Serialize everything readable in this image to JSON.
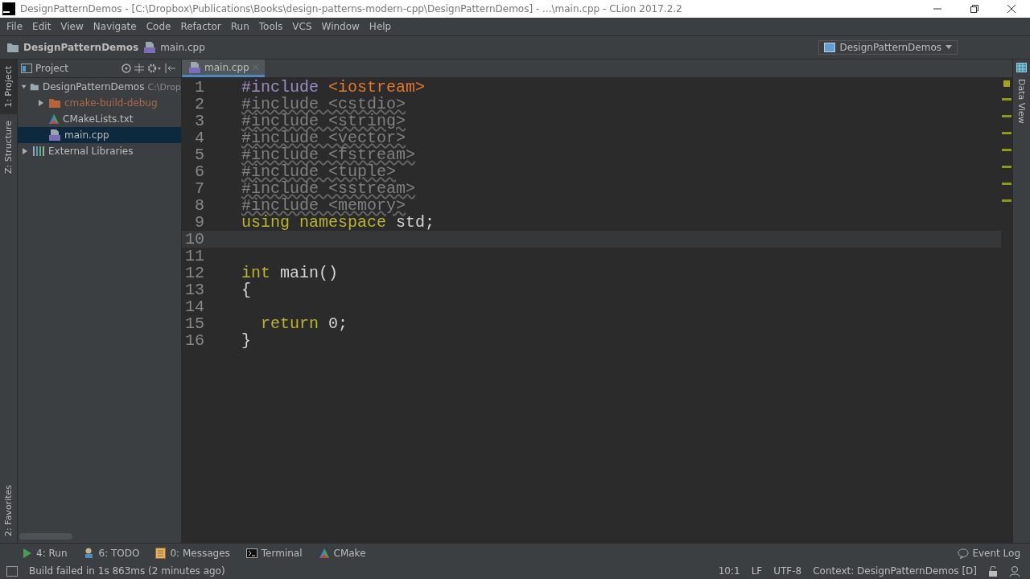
{
  "window": {
    "title": "DesignPatternDemos - [C:\\Dropbox\\Publications\\Books\\design-patterns-modern-cpp\\DesignPatternDemos] - ...\\main.cpp - CLion 2017.2.2"
  },
  "menu": [
    "File",
    "Edit",
    "View",
    "Navigate",
    "Code",
    "Refactor",
    "Run",
    "Tools",
    "VCS",
    "Window",
    "Help"
  ],
  "breadcrumbs": [
    {
      "label": "DesignPatternDemos",
      "kind": "folder"
    },
    {
      "label": "main.cpp",
      "kind": "cpp"
    }
  ],
  "run_config": {
    "label": "DesignPatternDemos"
  },
  "left_stripe": [
    {
      "label": "1: Project",
      "selected": true
    },
    {
      "label": "Z: Structure",
      "selected": false
    }
  ],
  "left_stripe_bottom": [
    {
      "label": "2: Favorites",
      "selected": false
    }
  ],
  "right_stripe": [
    {
      "label": "Data View",
      "selected": false
    }
  ],
  "project": {
    "title": "Project",
    "tree": [
      {
        "label": "DesignPatternDemos",
        "hint": "C:\\Drop",
        "kind": "folder",
        "expanded": true,
        "selected": false,
        "children": [
          {
            "label": "cmake-build-debug",
            "kind": "excluded",
            "expanded": false,
            "selected": false
          },
          {
            "label": "CMakeLists.txt",
            "kind": "cmake",
            "selected": false
          },
          {
            "label": "main.cpp",
            "kind": "cpp",
            "selected": true
          }
        ]
      },
      {
        "label": "External Libraries",
        "kind": "library",
        "expanded": false,
        "selected": false
      }
    ]
  },
  "editor_tabs": [
    {
      "label": "main.cpp",
      "selected": true
    }
  ],
  "code": {
    "lines": [
      {
        "number": "1",
        "current": false,
        "tokens": [
          {
            "text": "#include ",
            "kind": "directive"
          },
          {
            "text": "<iostream>",
            "kind": "header"
          }
        ]
      },
      {
        "number": "2",
        "current": false,
        "tokens": [
          {
            "text": "#include <cstdio>",
            "kind": "unused"
          }
        ]
      },
      {
        "number": "3",
        "current": false,
        "tokens": [
          {
            "text": "#include <string>",
            "kind": "unused"
          }
        ]
      },
      {
        "number": "4",
        "current": false,
        "tokens": [
          {
            "text": "#include <vector>",
            "kind": "unused"
          }
        ]
      },
      {
        "number": "5",
        "current": false,
        "tokens": [
          {
            "text": "#include <fstream>",
            "kind": "unused"
          }
        ]
      },
      {
        "number": "6",
        "current": false,
        "tokens": [
          {
            "text": "#include <tuple>",
            "kind": "unused"
          }
        ]
      },
      {
        "number": "7",
        "current": false,
        "tokens": [
          {
            "text": "#include <sstream>",
            "kind": "unused"
          }
        ]
      },
      {
        "number": "8",
        "current": false,
        "tokens": [
          {
            "text": "#include <memory>",
            "kind": "unused"
          }
        ]
      },
      {
        "number": "9",
        "current": false,
        "tokens": [
          {
            "text": "using namespace ",
            "kind": "keyword"
          },
          {
            "text": "std;",
            "kind": "plain"
          }
        ]
      },
      {
        "number": "10",
        "current": true
      },
      {
        "number": "11",
        "current": false
      },
      {
        "number": "12",
        "current": false,
        "tokens": [
          {
            "text": "int ",
            "kind": "keyword"
          },
          {
            "text": "main()",
            "kind": "plain"
          }
        ]
      },
      {
        "number": "13",
        "current": false,
        "tokens": [
          {
            "text": "{",
            "kind": "plain"
          }
        ]
      },
      {
        "number": "14",
        "current": false
      },
      {
        "number": "15",
        "current": false,
        "tokens": [
          {
            "text": "  return ",
            "kind": "keyword"
          },
          {
            "text": "0",
            "kind": "number"
          },
          {
            "text": ";",
            "kind": "plain"
          }
        ]
      },
      {
        "number": "16",
        "current": false,
        "tokens": [
          {
            "text": "}",
            "kind": "plain"
          }
        ]
      }
    ]
  },
  "tool_buttons": [
    {
      "label": "4: Run",
      "kind": "run"
    },
    {
      "label": "6: TODO",
      "kind": "todo"
    },
    {
      "label": "0: Messages",
      "kind": "messages"
    },
    {
      "label": "Terminal",
      "kind": "terminal"
    },
    {
      "label": "CMake",
      "kind": "cmake"
    }
  ],
  "event_log": "Event Log",
  "status_bar": {
    "message": "Build failed in 1s 863ms (2 minutes ago)",
    "position": "10:1",
    "line_separator": "LF",
    "encoding": "UTF-8",
    "context": "Context: DesignPatternDemos [D]"
  }
}
